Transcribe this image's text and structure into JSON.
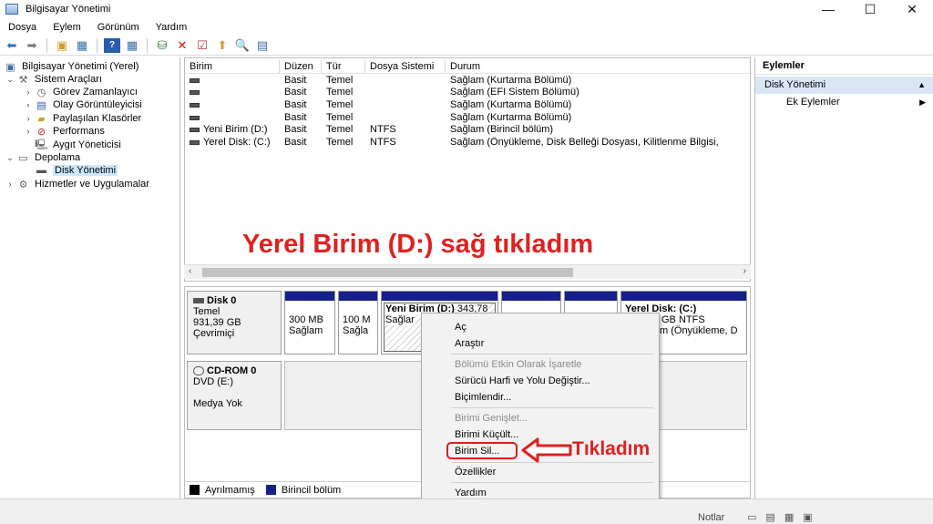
{
  "window": {
    "title": "Bilgisayar Yönetimi",
    "minimize": "—",
    "maximize": "☐",
    "close": "✕"
  },
  "menu": [
    "Dosya",
    "Eylem",
    "Görünüm",
    "Yardım"
  ],
  "tree": {
    "root": "Bilgisayar Yönetimi (Yerel)",
    "sistem_araclari": "Sistem Araçları",
    "gorev": "Görev Zamanlayıcı",
    "olay": "Olay Görüntüleyicisi",
    "paylasilan": "Paylaşılan Klasörler",
    "performans": "Performans",
    "aygit": "Aygıt Yöneticisi",
    "depolama": "Depolama",
    "disk_yonetimi": "Disk Yönetimi",
    "hizmetler": "Hizmetler ve Uygulamalar"
  },
  "volumes": {
    "headers": [
      "Birim",
      "Düzen",
      "Tür",
      "Dosya Sistemi",
      "Durum"
    ],
    "rows": [
      {
        "name": "",
        "layout": "Basit",
        "type": "Temel",
        "fs": "",
        "status": "Sağlam (Kurtarma Bölümü)"
      },
      {
        "name": "",
        "layout": "Basit",
        "type": "Temel",
        "fs": "",
        "status": "Sağlam (EFI Sistem Bölümü)"
      },
      {
        "name": "",
        "layout": "Basit",
        "type": "Temel",
        "fs": "",
        "status": "Sağlam (Kurtarma Bölümü)"
      },
      {
        "name": "",
        "layout": "Basit",
        "type": "Temel",
        "fs": "",
        "status": "Sağlam (Kurtarma Bölümü)"
      },
      {
        "name": "Yeni Birim (D:)",
        "layout": "Basit",
        "type": "Temel",
        "fs": "NTFS",
        "status": "Sağlam (Birincil bölüm)"
      },
      {
        "name": "Yerel Disk: (C:)",
        "layout": "Basit",
        "type": "Temel",
        "fs": "NTFS",
        "status": "Sağlam (Önyükleme, Disk Belleği Dosyası, Kilitlenme Bilgisi,"
      }
    ]
  },
  "annotation_top": "Yerel Birim (D:) sağ tıkladım",
  "annotation_bottom": "Tıkladım",
  "disk0": {
    "title": "Disk 0",
    "type": "Temel",
    "size": "931,39 GB",
    "state": "Çevrimiçi",
    "partitions": [
      {
        "l1": "300 MB",
        "l2": "Sağlam"
      },
      {
        "l1": "100 M",
        "l2": "Sağla"
      },
      {
        "l0": "Yeni Birim  (D:)",
        "l1": "343,78",
        "l2": "Sağlar"
      },
      {
        "l1": "",
        "l2": ""
      },
      {
        "l1": "",
        "l2": ""
      },
      {
        "l0": "Yerel Disk:  (C:)",
        "l1": "GB NTFS",
        "l2": "m (Önyükleme, D"
      }
    ]
  },
  "cdrom": {
    "title": "CD-ROM 0",
    "drive": "DVD (E:)",
    "state": "Medya Yok"
  },
  "legend": {
    "unallocated": "Ayrılmamış",
    "primary": "Birincil bölüm"
  },
  "actions": {
    "header": "Eylemler",
    "section": "Disk Yönetimi",
    "more": "Ek Eylemler"
  },
  "context_menu": {
    "open": "Aç",
    "explore": "Araştır",
    "mark_active": "Bölümü Etkin Olarak İşaretle",
    "change_letter": "Sürücü Harfi ve Yolu Değiştir...",
    "format": "Biçimlendir...",
    "extend": "Birimi Genişlet...",
    "shrink": "Birimi Küçült...",
    "delete": "Birim Sil...",
    "properties": "Özellikler",
    "help": "Yardım"
  },
  "status": {
    "notes": "Notlar"
  },
  "colors": {
    "primary_partition": "#16208a",
    "annotation": "#e02020",
    "unallocated": "#000000"
  }
}
